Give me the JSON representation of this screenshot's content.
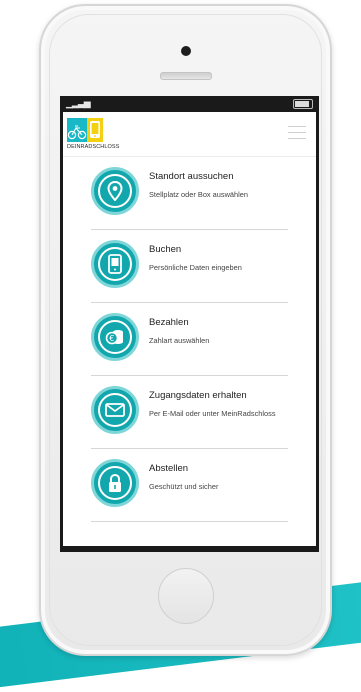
{
  "logo": {
    "wordmark": "DEINRADSCHLOSS"
  },
  "items": [
    {
      "title": "Standort aussuchen",
      "subtitle": "Stellplatz oder Box auswählen",
      "icon": "location-pin-icon"
    },
    {
      "title": "Buchen",
      "subtitle": "Persönliche Daten eingeben",
      "icon": "mobile-phone-icon"
    },
    {
      "title": "Bezahlen",
      "subtitle": "Zahlart auswählen",
      "icon": "coins-icon"
    },
    {
      "title": "Zugangsdaten erhalten",
      "subtitle": "Per E-Mail oder unter MeinRadschloss",
      "icon": "envelope-icon"
    },
    {
      "title": "Abstellen",
      "subtitle": "Geschützt und sicher",
      "icon": "padlock-icon"
    }
  ],
  "colors": {
    "accent": "#12a7ad",
    "accent_light": "#7fd6d8",
    "logo_blue": "#19b8c6",
    "logo_yellow": "#f2d012"
  }
}
